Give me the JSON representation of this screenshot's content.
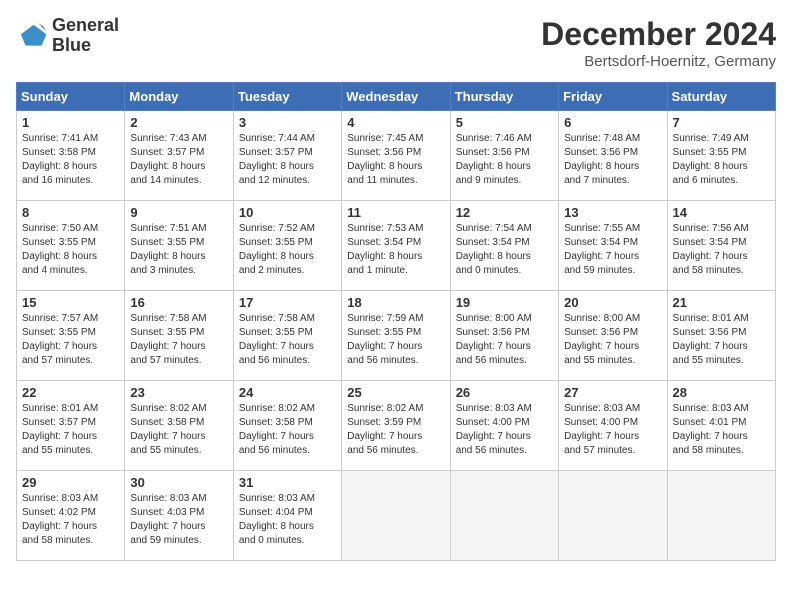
{
  "header": {
    "logo_line1": "General",
    "logo_line2": "Blue",
    "month_title": "December 2024",
    "location": "Bertsdorf-Hoernitz, Germany"
  },
  "weekdays": [
    "Sunday",
    "Monday",
    "Tuesday",
    "Wednesday",
    "Thursday",
    "Friday",
    "Saturday"
  ],
  "weeks": [
    [
      {
        "day": "1",
        "info": "Sunrise: 7:41 AM\nSunset: 3:58 PM\nDaylight: 8 hours\nand 16 minutes."
      },
      {
        "day": "2",
        "info": "Sunrise: 7:43 AM\nSunset: 3:57 PM\nDaylight: 8 hours\nand 14 minutes."
      },
      {
        "day": "3",
        "info": "Sunrise: 7:44 AM\nSunset: 3:57 PM\nDaylight: 8 hours\nand 12 minutes."
      },
      {
        "day": "4",
        "info": "Sunrise: 7:45 AM\nSunset: 3:56 PM\nDaylight: 8 hours\nand 11 minutes."
      },
      {
        "day": "5",
        "info": "Sunrise: 7:46 AM\nSunset: 3:56 PM\nDaylight: 8 hours\nand 9 minutes."
      },
      {
        "day": "6",
        "info": "Sunrise: 7:48 AM\nSunset: 3:56 PM\nDaylight: 8 hours\nand 7 minutes."
      },
      {
        "day": "7",
        "info": "Sunrise: 7:49 AM\nSunset: 3:55 PM\nDaylight: 8 hours\nand 6 minutes."
      }
    ],
    [
      {
        "day": "8",
        "info": "Sunrise: 7:50 AM\nSunset: 3:55 PM\nDaylight: 8 hours\nand 4 minutes."
      },
      {
        "day": "9",
        "info": "Sunrise: 7:51 AM\nSunset: 3:55 PM\nDaylight: 8 hours\nand 3 minutes."
      },
      {
        "day": "10",
        "info": "Sunrise: 7:52 AM\nSunset: 3:55 PM\nDaylight: 8 hours\nand 2 minutes."
      },
      {
        "day": "11",
        "info": "Sunrise: 7:53 AM\nSunset: 3:54 PM\nDaylight: 8 hours\nand 1 minute."
      },
      {
        "day": "12",
        "info": "Sunrise: 7:54 AM\nSunset: 3:54 PM\nDaylight: 8 hours\nand 0 minutes."
      },
      {
        "day": "13",
        "info": "Sunrise: 7:55 AM\nSunset: 3:54 PM\nDaylight: 7 hours\nand 59 minutes."
      },
      {
        "day": "14",
        "info": "Sunrise: 7:56 AM\nSunset: 3:54 PM\nDaylight: 7 hours\nand 58 minutes."
      }
    ],
    [
      {
        "day": "15",
        "info": "Sunrise: 7:57 AM\nSunset: 3:55 PM\nDaylight: 7 hours\nand 57 minutes."
      },
      {
        "day": "16",
        "info": "Sunrise: 7:58 AM\nSunset: 3:55 PM\nDaylight: 7 hours\nand 57 minutes."
      },
      {
        "day": "17",
        "info": "Sunrise: 7:58 AM\nSunset: 3:55 PM\nDaylight: 7 hours\nand 56 minutes."
      },
      {
        "day": "18",
        "info": "Sunrise: 7:59 AM\nSunset: 3:55 PM\nDaylight: 7 hours\nand 56 minutes."
      },
      {
        "day": "19",
        "info": "Sunrise: 8:00 AM\nSunset: 3:56 PM\nDaylight: 7 hours\nand 56 minutes."
      },
      {
        "day": "20",
        "info": "Sunrise: 8:00 AM\nSunset: 3:56 PM\nDaylight: 7 hours\nand 55 minutes."
      },
      {
        "day": "21",
        "info": "Sunrise: 8:01 AM\nSunset: 3:56 PM\nDaylight: 7 hours\nand 55 minutes."
      }
    ],
    [
      {
        "day": "22",
        "info": "Sunrise: 8:01 AM\nSunset: 3:57 PM\nDaylight: 7 hours\nand 55 minutes."
      },
      {
        "day": "23",
        "info": "Sunrise: 8:02 AM\nSunset: 3:58 PM\nDaylight: 7 hours\nand 55 minutes."
      },
      {
        "day": "24",
        "info": "Sunrise: 8:02 AM\nSunset: 3:58 PM\nDaylight: 7 hours\nand 56 minutes."
      },
      {
        "day": "25",
        "info": "Sunrise: 8:02 AM\nSunset: 3:59 PM\nDaylight: 7 hours\nand 56 minutes."
      },
      {
        "day": "26",
        "info": "Sunrise: 8:03 AM\nSunset: 4:00 PM\nDaylight: 7 hours\nand 56 minutes."
      },
      {
        "day": "27",
        "info": "Sunrise: 8:03 AM\nSunset: 4:00 PM\nDaylight: 7 hours\nand 57 minutes."
      },
      {
        "day": "28",
        "info": "Sunrise: 8:03 AM\nSunset: 4:01 PM\nDaylight: 7 hours\nand 58 minutes."
      }
    ],
    [
      {
        "day": "29",
        "info": "Sunrise: 8:03 AM\nSunset: 4:02 PM\nDaylight: 7 hours\nand 58 minutes."
      },
      {
        "day": "30",
        "info": "Sunrise: 8:03 AM\nSunset: 4:03 PM\nDaylight: 7 hours\nand 59 minutes."
      },
      {
        "day": "31",
        "info": "Sunrise: 8:03 AM\nSunset: 4:04 PM\nDaylight: 8 hours\nand 0 minutes."
      },
      null,
      null,
      null,
      null
    ]
  ]
}
